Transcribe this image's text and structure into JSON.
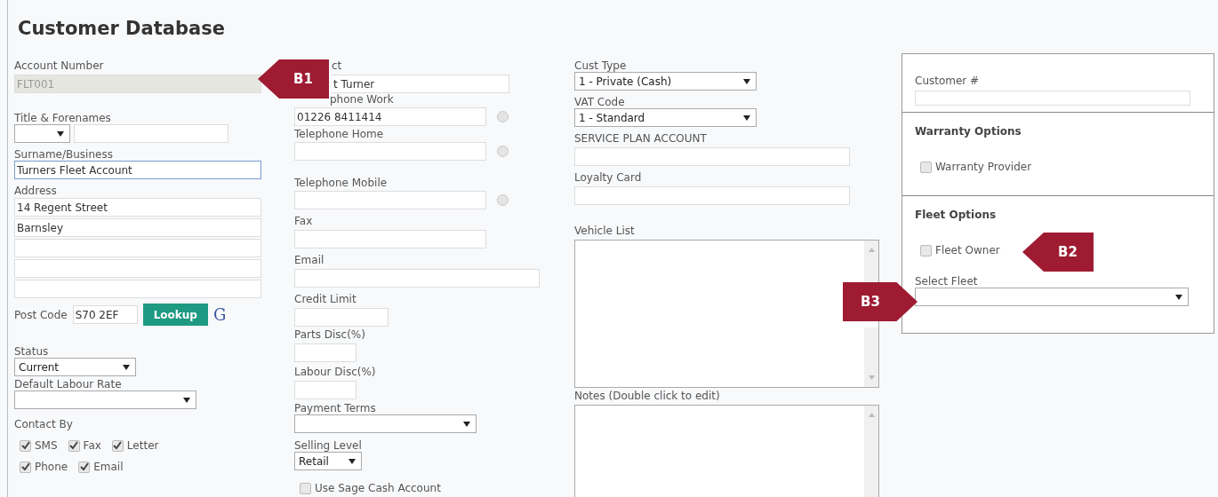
{
  "title": "Customer Database",
  "account_number": {
    "label": "Account Number",
    "value": "FLT001",
    "disabled": true
  },
  "title_forenames": {
    "label": "Title & Forenames"
  },
  "surname": {
    "label": "Surname/Business",
    "value": "Turners Fleet Account",
    "focused": true
  },
  "address": {
    "label": "Address",
    "lines": [
      "14 Regent Street",
      "Barnsley"
    ]
  },
  "post_code": {
    "label": "Post Code",
    "value": "S70 2EF",
    "button": "Lookup",
    "link": "G"
  },
  "status": {
    "label": "Status",
    "value": "Current"
  },
  "default_labour_rate": {
    "label": "Default Labour Rate"
  },
  "contact_by": {
    "label": "Contact By",
    "options": [
      {
        "label": "SMS",
        "checked": true
      },
      {
        "label": "Fax",
        "checked": true
      },
      {
        "label": "Letter",
        "checked": true
      },
      {
        "label": "Phone",
        "checked": true
      },
      {
        "label": "Email",
        "checked": true
      }
    ]
  },
  "contact": {
    "label": "ct",
    "value": "t Turner"
  },
  "phones": [
    {
      "label": "phone Work",
      "value": "01226 8411414",
      "selected": false
    },
    {
      "label": "Telephone Home",
      "selected": false
    },
    {
      "label": "Telephone Mobile",
      "selected": false
    }
  ],
  "fax": {
    "label": "Fax"
  },
  "email": {
    "label": "Email"
  },
  "credit_limit": {
    "label": "Credit Limit"
  },
  "parts_disc": {
    "label": "Parts Disc(%)"
  },
  "labour_disc": {
    "label": "Labour Disc(%)"
  },
  "payment_terms": {
    "label": "Payment Terms"
  },
  "selling_level": {
    "label": "Selling Level",
    "value": "Retail"
  },
  "use_sage": {
    "label": "Use Sage Cash Account",
    "checked": false
  },
  "cust_type": {
    "label": "Cust Type",
    "value": "1 - Private (Cash)"
  },
  "vat_code": {
    "label": "VAT Code",
    "value": "1 - Standard"
  },
  "service_plan": {
    "label": "SERVICE PLAN ACCOUNT"
  },
  "loyalty_card": {
    "label": "Loyalty Card"
  },
  "vehicle_list": {
    "label": "Vehicle List"
  },
  "notes": {
    "label": "Notes (Double click to edit)"
  },
  "customer_no": {
    "label": "Customer #"
  },
  "warranty_options": {
    "heading": "Warranty Options",
    "options": [
      {
        "label": "Warranty Provider",
        "checked": false
      }
    ]
  },
  "fleet_options": {
    "heading": "Fleet Options",
    "options": [
      {
        "label": "Fleet Owner",
        "checked": false
      }
    ],
    "select_label": "Select Fleet"
  },
  "callouts": [
    {
      "label": "B1"
    },
    {
      "label": "B2"
    },
    {
      "label": "B3"
    }
  ]
}
